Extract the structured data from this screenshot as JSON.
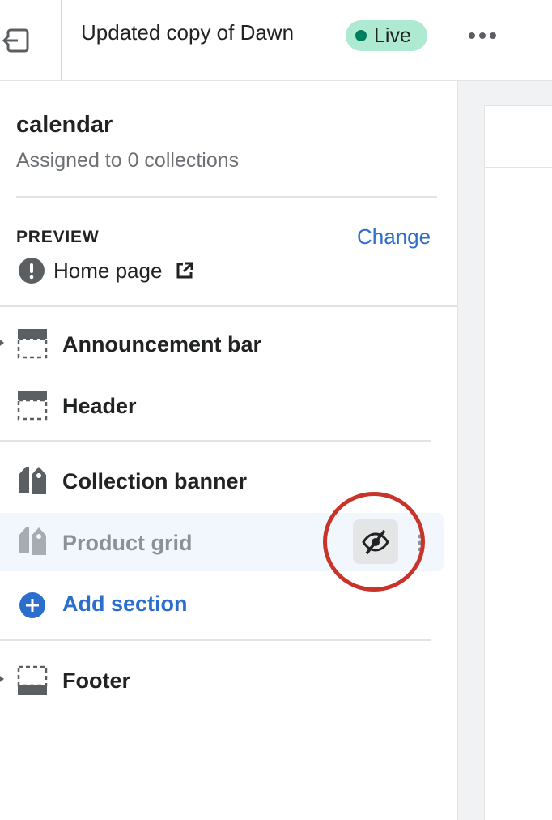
{
  "topbar": {
    "exit_icon": "exit-icon",
    "theme_name": "Updated copy of Dawn",
    "status_badge": "Live",
    "more_icon": "more-horizontal-icon"
  },
  "template": {
    "title": "calendar",
    "subtitle": "Assigned to 0 collections"
  },
  "preview": {
    "label": "PREVIEW",
    "change_label": "Change",
    "page": "Home page",
    "info_icon": "alert-circle-icon",
    "external_icon": "external-link-icon"
  },
  "sections": {
    "header_group": [
      {
        "label": "Announcement bar",
        "icon": "header-layout-icon",
        "expandable": true
      },
      {
        "label": "Header",
        "icon": "header-layout-icon",
        "expandable": false
      }
    ],
    "template_group": [
      {
        "label": "Collection banner",
        "icon": "collection-tag-icon",
        "hidden": false
      },
      {
        "label": "Product grid",
        "icon": "collection-tag-icon",
        "hidden": true,
        "visibility_icon": "eye-hidden-icon"
      }
    ],
    "add_section_label": "Add section",
    "footer_group": [
      {
        "label": "Footer",
        "icon": "footer-layout-icon",
        "expandable": true
      }
    ]
  },
  "colors": {
    "accent": "#2c6ecb",
    "live_badge_bg": "#aee9d1",
    "live_dot": "#007f5f",
    "highlight_ring": "#c9342a",
    "hidden_row_bg": "#f2f7fe"
  }
}
